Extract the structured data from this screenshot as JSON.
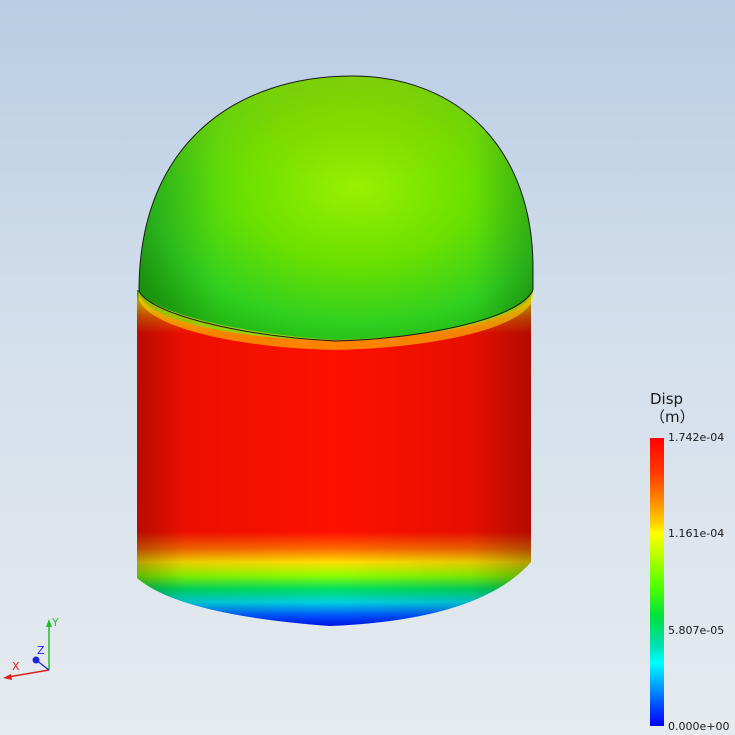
{
  "legend": {
    "title": "Disp",
    "unit": "（m）",
    "labels": [
      "1.742e-04",
      "1.161e-04",
      "5.807e-05",
      "0.000e+00"
    ]
  },
  "triad": {
    "x_label": "X",
    "y_label": "Y",
    "z_label": "Z",
    "x_color": "#e02020",
    "y_color": "#20c020",
    "z_color": "#2020e0"
  },
  "colors": {
    "max": "#ff0000",
    "mid": "#ffff00",
    "low": "#00ff00",
    "min": "#0000ff"
  }
}
